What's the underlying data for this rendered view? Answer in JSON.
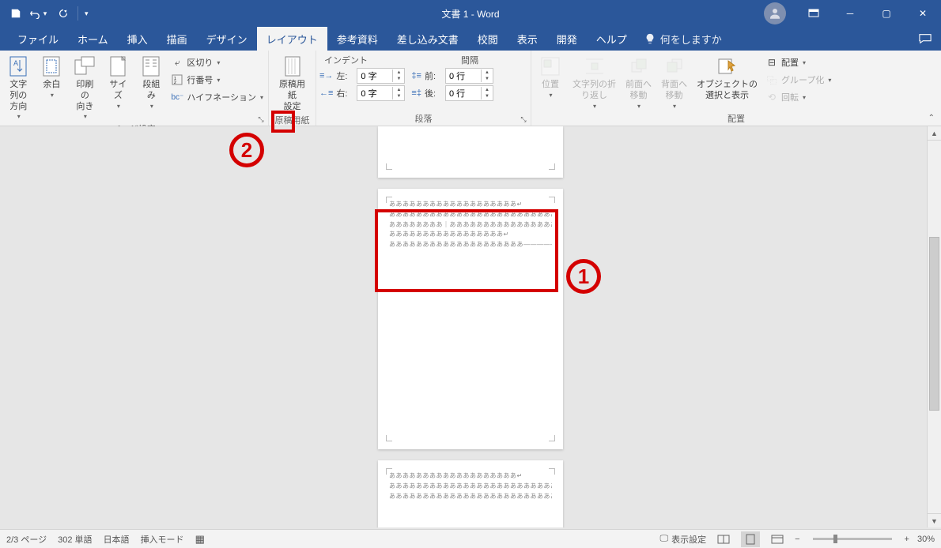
{
  "title": "文書 1  -  Word",
  "qat": {
    "save": "save",
    "undo": "undo",
    "redo": "redo"
  },
  "tabs": [
    "ファイル",
    "ホーム",
    "挿入",
    "描画",
    "デザイン",
    "レイアウト",
    "参考資料",
    "差し込み文書",
    "校閲",
    "表示",
    "開発",
    "ヘルプ"
  ],
  "active_tab_index": 5,
  "tellme": {
    "placeholder": "何をしますか"
  },
  "ribbon": {
    "page_setup": {
      "label": "ページ設定",
      "text_direction": "文字列の\n方向",
      "margins": "余白",
      "orientation": "印刷の\n向き",
      "size": "サイズ",
      "columns": "段組み",
      "breaks": "区切り",
      "line_numbers": "行番号",
      "hyphenation": "ハイフネーション"
    },
    "genkou": {
      "label": "原稿用紙",
      "button": "原稿用紙\n設定"
    },
    "paragraph": {
      "label": "段落",
      "indent_header": "インデント",
      "spacing_header": "間隔",
      "left_label": "左:",
      "left_value": "0 字",
      "right_label": "右:",
      "right_value": "0 字",
      "before_label": "前:",
      "before_value": "0 行",
      "after_label": "後:",
      "after_value": "0 行"
    },
    "arrange": {
      "label": "配置",
      "position": "位置",
      "wrap": "文字列の折\nり返し",
      "bring_forward": "前面へ\n移動",
      "send_backward": "背面へ\n移動",
      "selection_pane": "オブジェクトの\n選択と表示",
      "align": "配置",
      "group": "グループ化",
      "rotate": "回転"
    }
  },
  "document": {
    "line_a": "あああああああああああああああああああ↵",
    "line_b": "ああああああああああああああああああああああああああああああ",
    "line_c": "ああああああああ｜ああああああああああああああああああああああ",
    "line_d": "あああああああああああああああああ↵",
    "line_e": "ああああああああああああああああああああ―――――――――――"
  },
  "status": {
    "page": "2/3 ページ",
    "words": "302 単語",
    "language": "日本語",
    "insert_mode": "挿入モード",
    "display_settings": "表示設定",
    "zoom": "30%"
  },
  "annotations": {
    "one": "1",
    "two": "2"
  }
}
